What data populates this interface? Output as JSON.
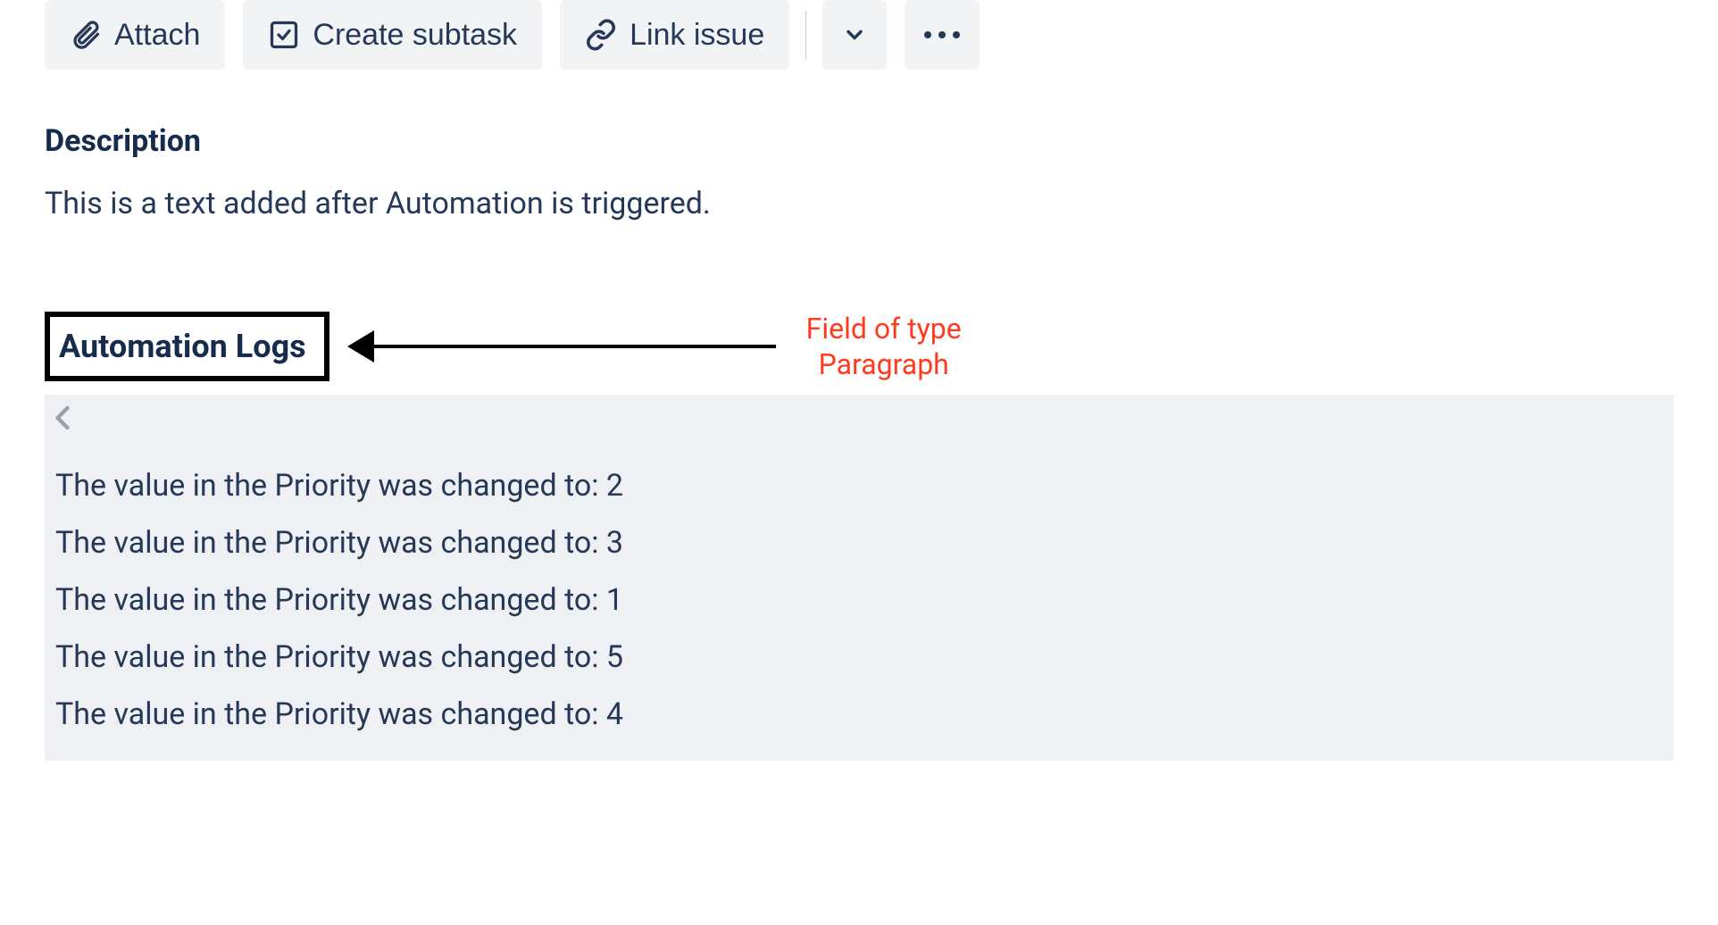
{
  "toolbar": {
    "attach_label": "Attach",
    "create_subtask_label": "Create subtask",
    "link_issue_label": "Link issue"
  },
  "description": {
    "heading": "Description",
    "text": "This is a text added after Automation is triggered."
  },
  "automation": {
    "heading": "Automation Logs",
    "annotation_line1": "Field of type",
    "annotation_line2": "Paragraph",
    "logs": [
      "The value in the Priority was changed to: 2",
      "The value in the Priority was changed to: 3",
      "The value in the Priority was changed to: 1",
      "The value in the Priority was changed to: 5",
      "The value in the Priority was changed to: 4"
    ]
  }
}
